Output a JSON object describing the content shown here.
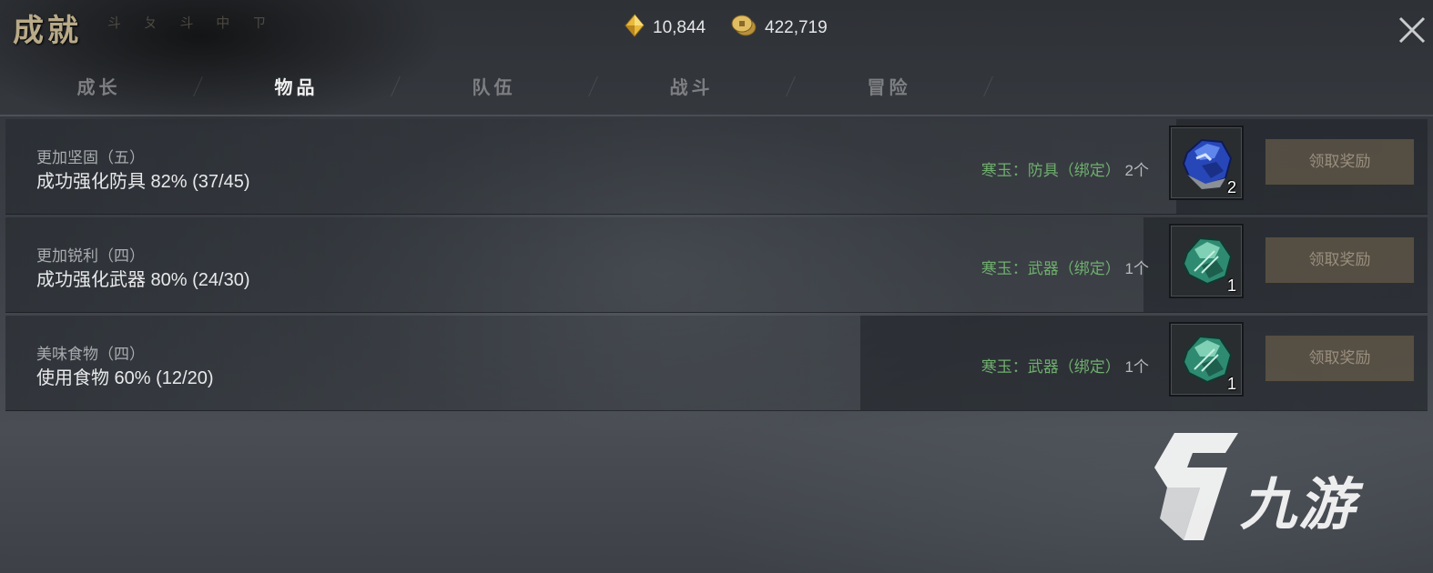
{
  "header": {
    "title": "成就",
    "title_decoration": "斗 ㄆ 斗 中 ㄗ",
    "currencies": [
      {
        "icon": "gold-diamond-icon",
        "value": "10,844"
      },
      {
        "icon": "coin-icon",
        "value": "422,719"
      }
    ],
    "close_icon": "close-icon"
  },
  "tabs": [
    {
      "label": "成长",
      "active": false
    },
    {
      "label": "物品",
      "active": true
    },
    {
      "label": "队伍",
      "active": false
    },
    {
      "label": "战斗",
      "active": false
    },
    {
      "label": "冒险",
      "active": false
    }
  ],
  "achievements": [
    {
      "name": "更加坚固（五）",
      "description": "成功强化防具 82% (37/45)",
      "reward_name": "寒玉：防具（绑定）",
      "reward_count": "2个",
      "item_icon": "blue-jade-icon",
      "item_qty": "2",
      "claim_label": "领取奖励"
    },
    {
      "name": "更加锐利（四）",
      "description": "成功强化武器 80% (24/30)",
      "reward_name": "寒玉：武器（绑定）",
      "reward_count": "1个",
      "item_icon": "green-jade-icon",
      "item_qty": "1",
      "claim_label": "领取奖励"
    },
    {
      "name": "美味食物（四）",
      "description": "使用食物 60% (12/20)",
      "reward_name": "寒玉：武器（绑定）",
      "reward_count": "1个",
      "item_icon": "green-jade-icon",
      "item_qty": "1",
      "claim_label": "领取奖励"
    }
  ],
  "watermark": {
    "text": "九游",
    "icon": "9game-logo-icon"
  },
  "colors": {
    "title": "#b9aa88",
    "reward_green": "#6fae6e",
    "claim_button": "#706250",
    "tab_active": "#f1f1f1",
    "tab_inactive": "#7d7f82"
  }
}
